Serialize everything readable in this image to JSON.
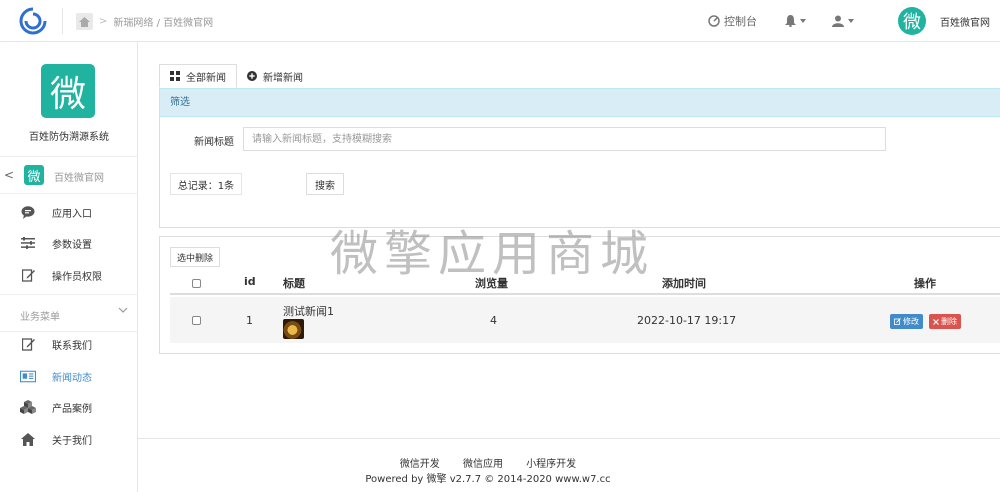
{
  "breadcrumb": {
    "path": "新瑞网络 / 百姓微官网"
  },
  "top_nav": {
    "console": "控制台",
    "account_name": "百姓微官网",
    "avatar_char": "微"
  },
  "sidebar": {
    "logo_char": "微",
    "app_name": "百姓防伪溯源系统",
    "account": {
      "logo_char": "微",
      "name": "百姓微官网"
    },
    "items": [
      {
        "label": "应用入口",
        "icon": "chat-bubble-icon"
      },
      {
        "label": "参数设置",
        "icon": "sliders-icon"
      },
      {
        "label": "操作员权限",
        "icon": "edit-icon"
      }
    ],
    "section": {
      "label": "业务菜单"
    },
    "business_items": [
      {
        "label": "联系我们",
        "icon": "edit-icon"
      },
      {
        "label": "新闻动态",
        "icon": "newspaper-icon",
        "active": true
      },
      {
        "label": "产品案例",
        "icon": "cubes-icon"
      },
      {
        "label": "关于我们",
        "icon": "home-icon"
      }
    ]
  },
  "tabs": [
    {
      "label": "全部新闻",
      "icon": "grid-icon",
      "active": true
    },
    {
      "label": "新增新闻",
      "icon": "plus-circle-icon"
    }
  ],
  "filter": {
    "heading": "筛选",
    "title_label": "新闻标题",
    "title_placeholder": "请输入新闻标题，支持模糊搜索",
    "total": "总记录：1条",
    "search_button": "搜索"
  },
  "table": {
    "delete_selected": "选中删除",
    "columns": [
      "id",
      "标题",
      "浏览量",
      "添加时间",
      "操作"
    ],
    "rows": [
      {
        "id": "1",
        "title": "测试新闻1",
        "views": "4",
        "time": "2022-10-17 19:17"
      }
    ],
    "edit_label": "修改",
    "delete_label": "删除"
  },
  "watermark": "微擎应用商城",
  "footer": {
    "links": [
      "微信开发",
      "微信应用",
      "小程序开发"
    ],
    "powered": "Powered by 微擎 v2.7.7 © 2014-2020 www.w7.cc"
  },
  "colors": {
    "accent": "#1fb3a0",
    "primary": "#428bca",
    "danger": "#d9534f",
    "info_bg": "#d9edf7"
  }
}
